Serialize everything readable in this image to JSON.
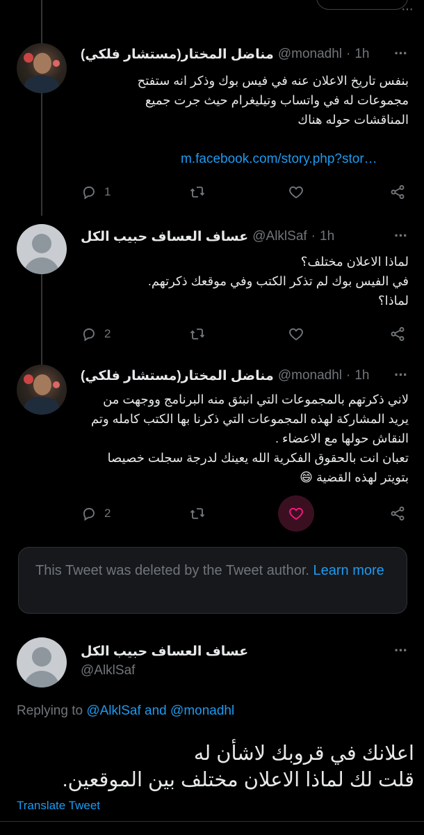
{
  "tweets": [
    {
      "name": "مناضل المختار(مستشار فلكي)",
      "handle": "@monadhl",
      "time": "1h",
      "text": "بنفس تاريخ الاعلان عنه في فيس بوك وذكر انه ستفتح\nمجموعات له في واتساب وتيليغرام حيث جرت جميع\nالمناقشات حوله هناك",
      "link": "m.facebook.com/story.php?stor…",
      "reply_count": "1",
      "avatar": "photo"
    },
    {
      "name": "عساف العساف حبيب الكل",
      "handle": "@AlklSaf",
      "time": "1h",
      "text": "لماذا الاعلان مختلف؟\nفي الفيس بوك لم تذكر الكتب وفي موقعك ذكرتهم.\nلماذا؟",
      "reply_count": "2",
      "avatar": "default"
    },
    {
      "name": "مناضل المختار(مستشار فلكي)",
      "handle": "@monadhl",
      "time": "1h",
      "text": "لاني ذكرتهم بالمجموعات التي انبثق منه البرنامج ووجهت من\nيريد المشاركة لهذه المجموعات التي ذكرنا بها الكتب كامله وتم\nالنقاش حولها مع الاعضاء .\nتعبان انت بالحقوق الفكرية الله يعينك لدرجة سجلت خصيصا\nبتويتر لهذه القضية 😄",
      "reply_count": "2",
      "avatar": "photo",
      "liked": true
    }
  ],
  "deleted_notice": {
    "text": "This Tweet was deleted by the Tweet author.",
    "link": "Learn more"
  },
  "main_tweet": {
    "name": "عساف العساف حبيب الكل",
    "handle": "@AlklSaf",
    "replying_prefix": "Replying to",
    "replying_to_1": "@AlklSaf",
    "replying_and": "and",
    "replying_to_2": "@monadhl",
    "text": "اعلانك في قروبك لاشأن له\nقلت لك لماذا الاعلان مختلف بين الموقعين.",
    "translate": "Translate Tweet"
  },
  "icons": [
    "reply-icon",
    "retweet-icon",
    "like-icon",
    "share-icon",
    "more-icon"
  ],
  "colors": {
    "accent": "#1d9bf0",
    "like_active_bg": "#3a1021",
    "like_active": "#f91880",
    "muted": "#71767b"
  }
}
